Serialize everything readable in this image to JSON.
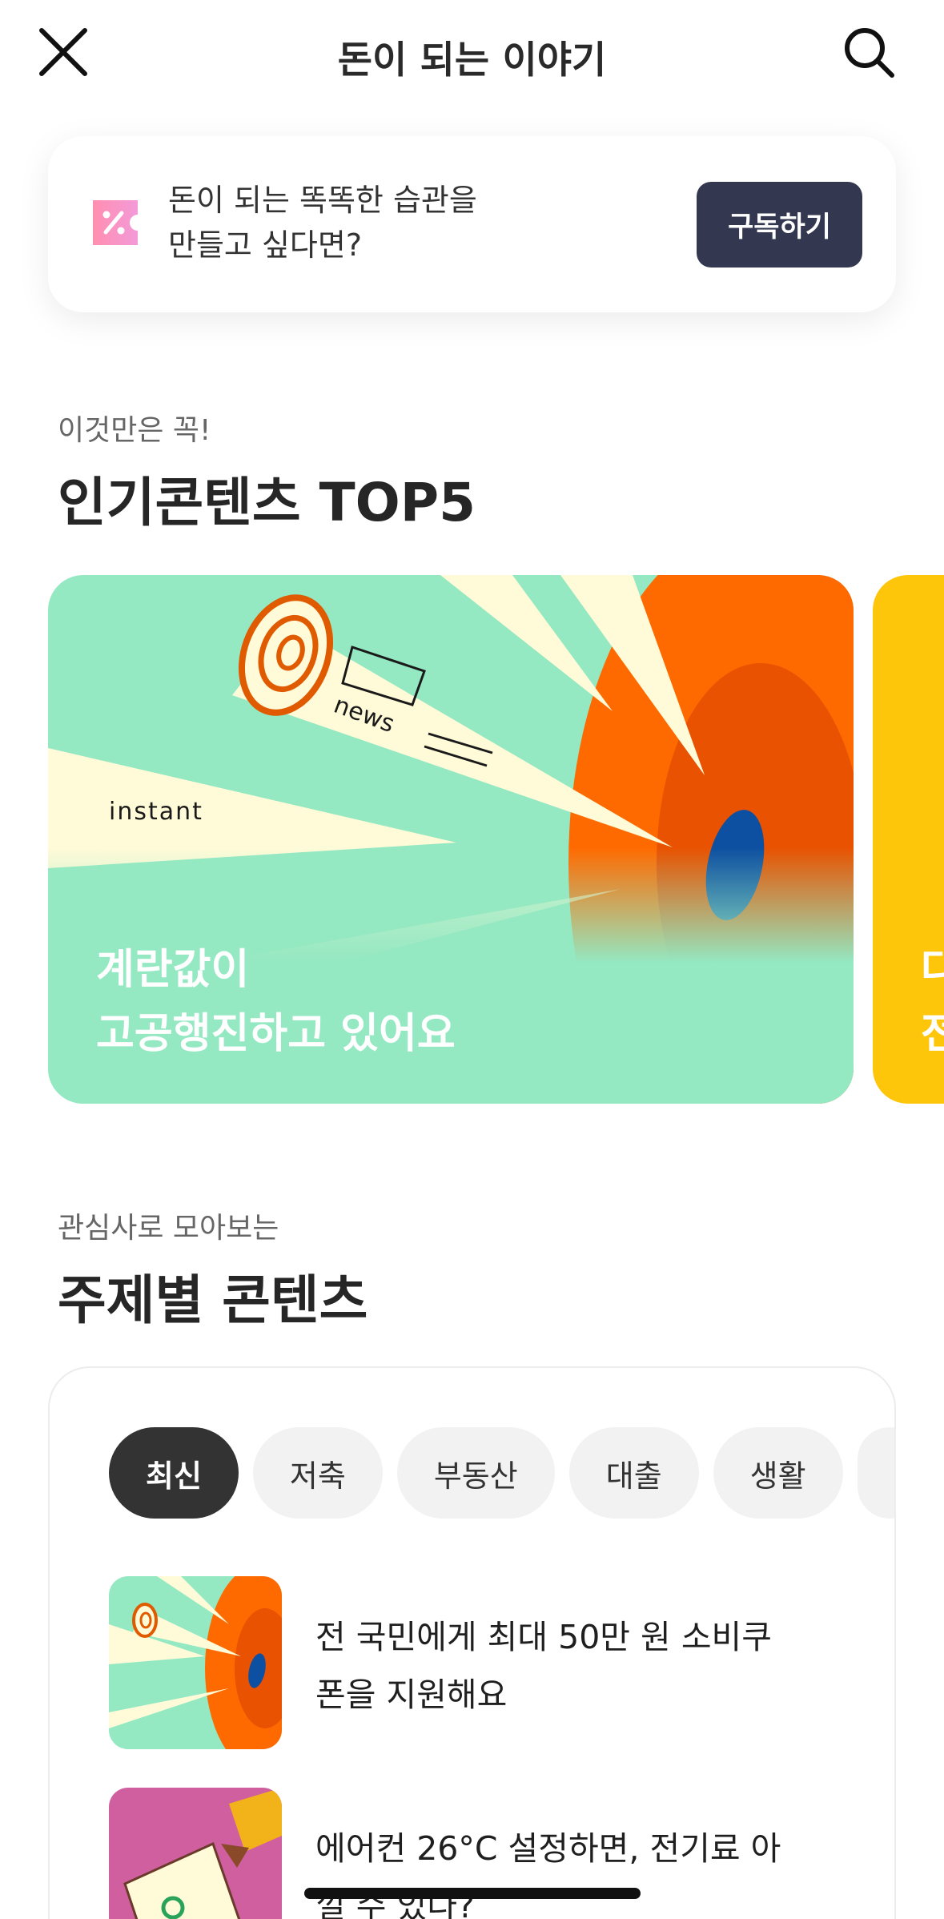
{
  "header": {
    "title": "돈이 되는 이야기",
    "close_icon": "close-icon",
    "search_icon": "search-icon"
  },
  "promo": {
    "icon": "coupon-icon",
    "line1": "돈이 되는 똑똑한 습관을",
    "line2": "만들고 싶다면?",
    "button_label": "구독하기"
  },
  "popular": {
    "subtitle": "이것만은 꼭!",
    "title": "인기콘텐츠 TOP5",
    "cards": [
      {
        "line1": "계란값이",
        "line2": "고공행진하고 있어요",
        "art_words": [
          "news",
          "instant"
        ]
      },
      {
        "line1": "다",
        "line2": "전"
      }
    ]
  },
  "topics": {
    "subtitle": "관심사로 모아보는",
    "title": "주제별 콘텐츠",
    "chips": [
      {
        "label": "최신",
        "active": true
      },
      {
        "label": "저축",
        "active": false
      },
      {
        "label": "부동산",
        "active": false
      },
      {
        "label": "대출",
        "active": false
      },
      {
        "label": "생활",
        "active": false
      }
    ],
    "articles": [
      {
        "line1": "전 국민에게 최대 50만 원 소비쿠",
        "line2": "폰을 지원해요"
      },
      {
        "line1": "에어컨 26°C 설정하면, 전기료 아",
        "line2": "낄 수 있다?"
      }
    ]
  },
  "colors": {
    "mint": "#94e8c2",
    "orange": "#ff6a00",
    "navy_button": "#333850",
    "yellow": "#fdc60a",
    "pink": "#d05fa0"
  }
}
